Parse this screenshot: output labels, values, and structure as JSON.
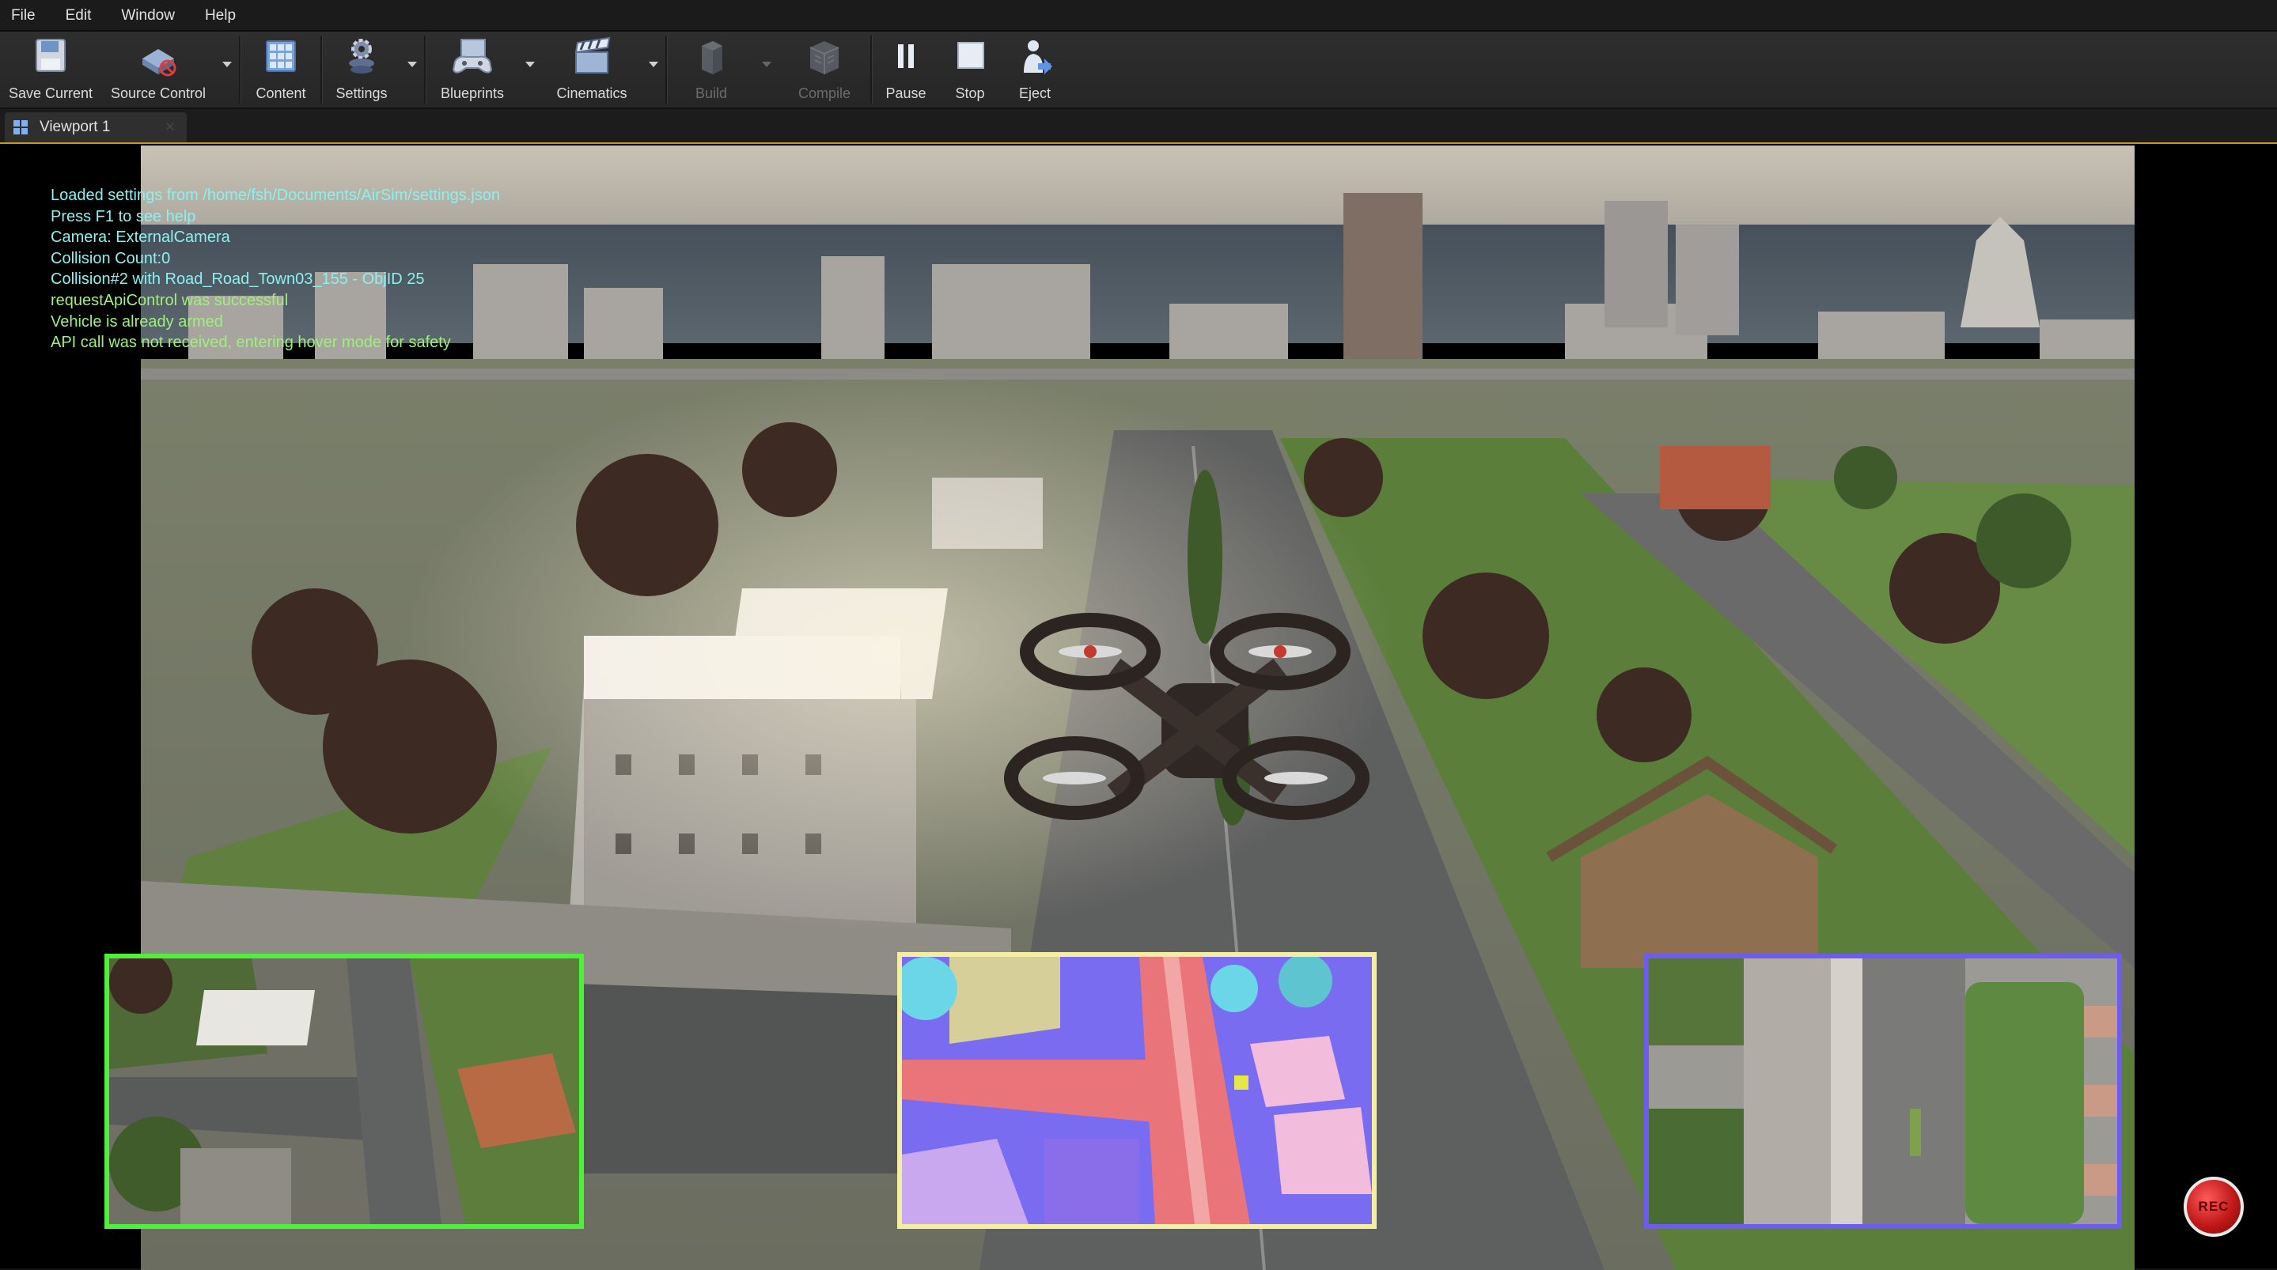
{
  "menu": [
    "File",
    "Edit",
    "Window",
    "Help"
  ],
  "toolbar": {
    "save_current": "Save Current",
    "source_control": "Source Control",
    "content": "Content",
    "settings": "Settings",
    "blueprints": "Blueprints",
    "cinematics": "Cinematics",
    "build": "Build",
    "compile": "Compile",
    "pause": "Pause",
    "stop": "Stop",
    "eject": "Eject"
  },
  "tab": {
    "label": "Viewport 1"
  },
  "log": [
    "Loaded settings from /home/fsh/Documents/AirSim/settings.json",
    "Press F1 to see help",
    "Camera: ExternalCamera",
    "Collision Count:0",
    "Collision#2 with Road_Road_Town03_155 - ObjID 25",
    "requestApiControl was successful",
    "Vehicle is already armed",
    "API call was not received, entering hover mode for safety"
  ],
  "record": {
    "label": "REC"
  },
  "colors": {
    "accent_border": "#c29a2b",
    "scene_window_border": "#4ef03c",
    "segmentation_window_border": "#f4eea2",
    "depth_window_border": "#6e5cf0",
    "log_text": "#8df0f0",
    "log_text_alert": "#9ff07a",
    "record_button": "#c11818"
  },
  "icons": {
    "save_current": "floppy-disk-icon",
    "source_control": "source-control-disabled-icon",
    "content": "content-browser-icon",
    "settings": "settings-gears-icon",
    "blueprints": "blueprint-controller-icon",
    "cinematics": "clapperboard-icon",
    "build": "build-blocks-icon",
    "compile": "compile-cube-icon",
    "pause": "pause-icon",
    "stop": "stop-icon",
    "eject": "eject-person-icon"
  }
}
